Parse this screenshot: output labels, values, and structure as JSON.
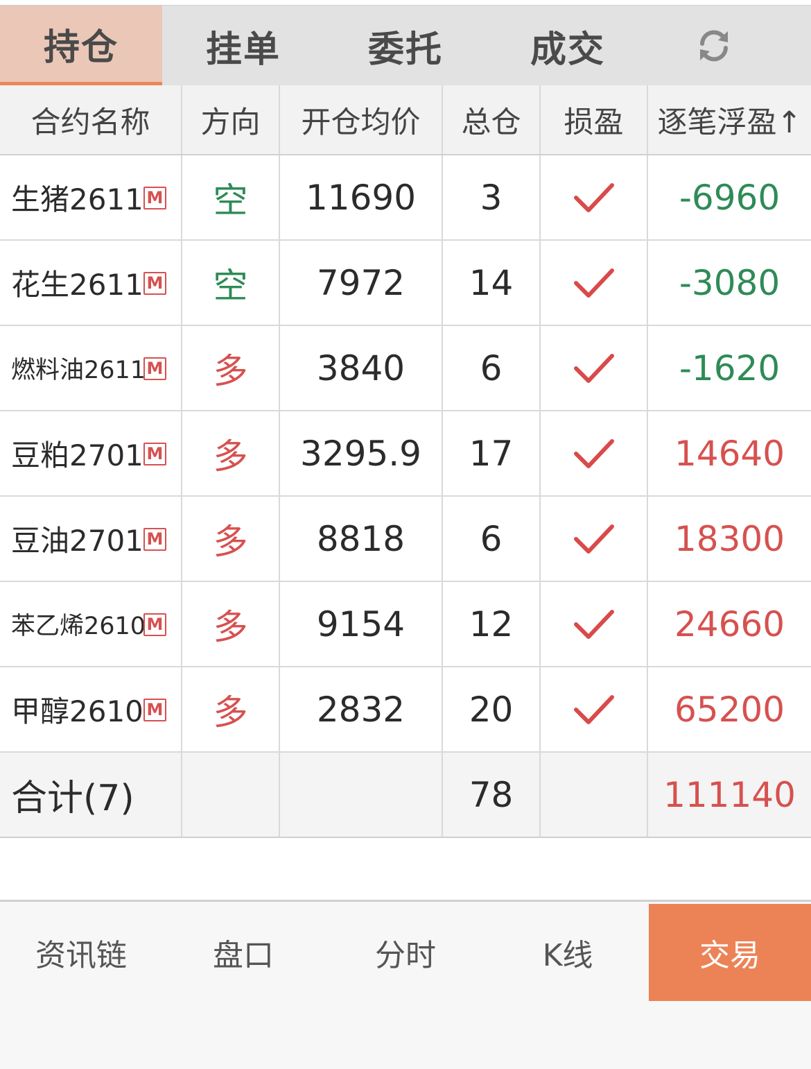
{
  "colors": {
    "accent": "#ec8357",
    "active_tab_bg": "#ebc7b8",
    "profit": "#d6514f",
    "loss": "#2e8b57"
  },
  "tabs": [
    "持仓",
    "挂单",
    "委托",
    "成交"
  ],
  "refresh_icon": "refresh-icon",
  "columns": [
    "合约名称",
    "方向",
    "开仓均价",
    "总仓",
    "损盈",
    "逐笔浮盈↑"
  ],
  "rows": [
    {
      "name": "生猪2611",
      "badge": "M",
      "direction": "空",
      "avg_price": "11690",
      "position": "3",
      "pl_check": "check-icon",
      "float_pl": "-6960"
    },
    {
      "name": "花生2611",
      "badge": "M",
      "direction": "空",
      "avg_price": "7972",
      "position": "14",
      "pl_check": "check-icon",
      "float_pl": "-3080"
    },
    {
      "name": "燃料油2611",
      "badge": "M",
      "direction": "多",
      "avg_price": "3840",
      "position": "6",
      "pl_check": "check-icon",
      "float_pl": "-1620"
    },
    {
      "name": "豆粕2701",
      "badge": "M",
      "direction": "多",
      "avg_price": "3295.9",
      "position": "17",
      "pl_check": "check-icon",
      "float_pl": "14640"
    },
    {
      "name": "豆油2701",
      "badge": "M",
      "direction": "多",
      "avg_price": "8818",
      "position": "6",
      "pl_check": "check-icon",
      "float_pl": "18300"
    },
    {
      "name": "苯乙烯2610",
      "badge": "M",
      "direction": "多",
      "avg_price": "9154",
      "position": "12",
      "pl_check": "check-icon",
      "float_pl": "24660"
    },
    {
      "name": "甲醇2610",
      "badge": "M",
      "direction": "多",
      "avg_price": "2832",
      "position": "20",
      "pl_check": "check-icon",
      "float_pl": "65200"
    }
  ],
  "total": {
    "label": "合计(7)",
    "position": "78",
    "float_pl": "111140"
  },
  "bottom_nav": [
    "资讯链",
    "盘口",
    "分时",
    "K线",
    "交易"
  ]
}
